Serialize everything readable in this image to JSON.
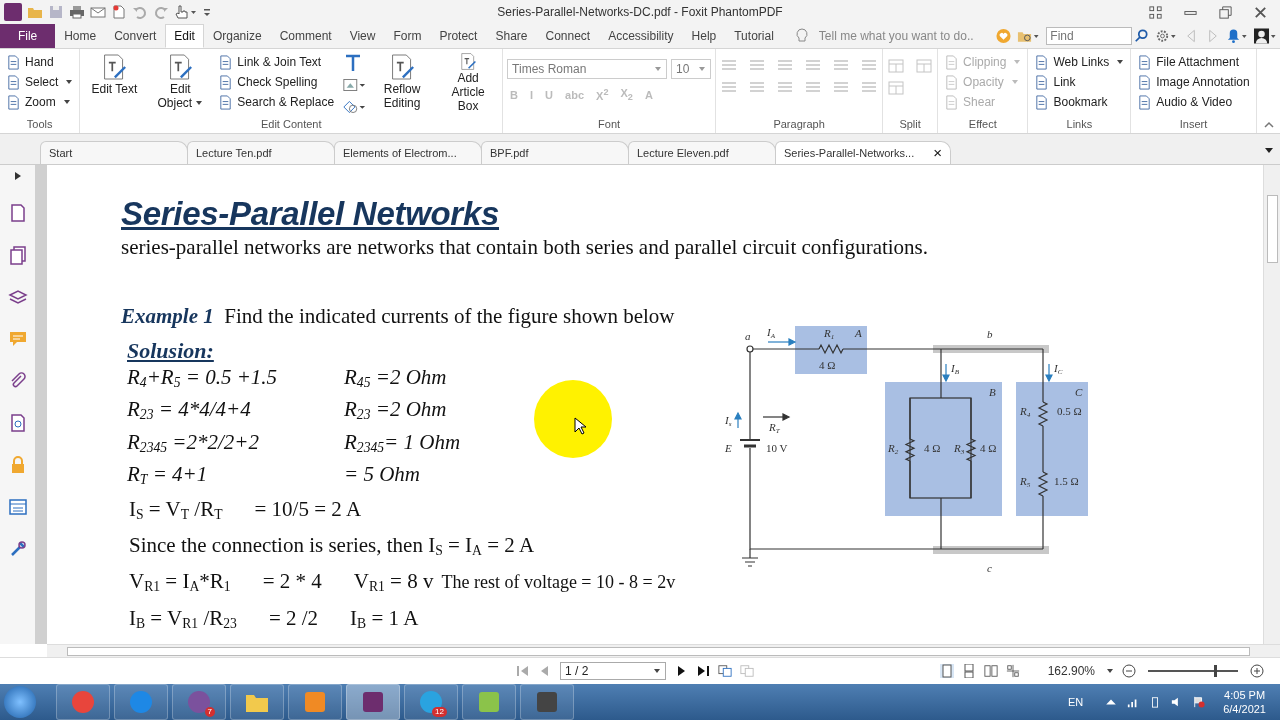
{
  "window": {
    "title": "Series-Parallel-Networks-DC.pdf - Foxit PhantomPDF"
  },
  "menu_tabs": [
    {
      "label": "File",
      "selected": false,
      "kind": "file"
    },
    {
      "label": "Home",
      "selected": false,
      "kind": "tab"
    },
    {
      "label": "Convert",
      "selected": false,
      "kind": "tab"
    },
    {
      "label": "Edit",
      "selected": true,
      "kind": "tab"
    },
    {
      "label": "Organize",
      "selected": false,
      "kind": "tab"
    },
    {
      "label": "Comment",
      "selected": false,
      "kind": "tab"
    },
    {
      "label": "View",
      "selected": false,
      "kind": "tab"
    },
    {
      "label": "Form",
      "selected": false,
      "kind": "tab"
    },
    {
      "label": "Protect",
      "selected": false,
      "kind": "tab"
    },
    {
      "label": "Share",
      "selected": false,
      "kind": "tab"
    },
    {
      "label": "Connect",
      "selected": false,
      "kind": "tab"
    },
    {
      "label": "Accessibility",
      "selected": false,
      "kind": "tab"
    },
    {
      "label": "Help",
      "selected": false,
      "kind": "tab"
    },
    {
      "label": "Tutorial",
      "selected": false,
      "kind": "tab"
    }
  ],
  "tell_me": {
    "placeholder": "Tell me what you want to do.."
  },
  "find": {
    "placeholder": "Find"
  },
  "ribbon_groups": [
    {
      "title": "Tools",
      "columns": [
        {
          "kind": "stack",
          "items": [
            {
              "label": "Hand",
              "dropdown": false,
              "disabled": false
            },
            {
              "label": "Select",
              "dropdown": true,
              "disabled": false
            },
            {
              "label": "Zoom",
              "dropdown": true,
              "disabled": false
            }
          ]
        }
      ]
    },
    {
      "title": "Edit Content",
      "columns": [
        {
          "kind": "large",
          "label": "Edit Text",
          "dropdown": false
        },
        {
          "kind": "large",
          "label": "Edit Object",
          "dropdown": true
        },
        {
          "kind": "stack",
          "items": [
            {
              "label": "Link & Join Text",
              "dropdown": false,
              "disabled": false
            },
            {
              "label": "Check Spelling",
              "dropdown": false,
              "disabled": false
            },
            {
              "label": "Search & Replace",
              "dropdown": false,
              "disabled": false
            }
          ]
        },
        {
          "kind": "format-icons"
        },
        {
          "kind": "large",
          "label": "Reflow Editing",
          "dropdown": false
        },
        {
          "kind": "large",
          "label": "Add Article Box",
          "dropdown": false
        }
      ]
    },
    {
      "title": "Font",
      "columns": [
        {
          "kind": "font",
          "font": "Times Roman",
          "size": "10",
          "buttons": [
            "B",
            "I",
            "U",
            "abc",
            "X$^{2}$",
            "X$_{2}$",
            "A"
          ]
        }
      ]
    },
    {
      "title": "Paragraph",
      "columns": [
        {
          "kind": "paragraph-icons"
        }
      ]
    },
    {
      "title": "Split",
      "columns": [
        {
          "kind": "split-icons"
        }
      ]
    },
    {
      "title": "Effect",
      "columns": [
        {
          "kind": "stack",
          "items": [
            {
              "label": "Clipping",
              "dropdown": true,
              "disabled": true
            },
            {
              "label": "Opacity",
              "dropdown": true,
              "disabled": true
            },
            {
              "label": "Shear",
              "dropdown": false,
              "disabled": true
            }
          ]
        }
      ]
    },
    {
      "title": "Links",
      "columns": [
        {
          "kind": "stack",
          "items": [
            {
              "label": "Web Links",
              "dropdown": true,
              "disabled": false
            },
            {
              "label": "Link",
              "dropdown": false,
              "disabled": false
            },
            {
              "label": "Bookmark",
              "dropdown": false,
              "disabled": false
            }
          ]
        }
      ]
    },
    {
      "title": "Insert",
      "columns": [
        {
          "kind": "stack",
          "items": [
            {
              "label": "File Attachment",
              "dropdown": false,
              "disabled": false
            },
            {
              "label": "Image Annotation",
              "dropdown": false,
              "disabled": false
            },
            {
              "label": "Audio & Video",
              "dropdown": false,
              "disabled": false
            }
          ]
        }
      ]
    }
  ],
  "doc_tabs": [
    {
      "label": "Start",
      "selected": false
    },
    {
      "label": "Lecture Ten.pdf",
      "selected": false
    },
    {
      "label": "Elements of Electrom...",
      "selected": false
    },
    {
      "label": "BPF.pdf",
      "selected": false
    },
    {
      "label": "Lecture Eleven.pdf",
      "selected": false
    },
    {
      "label": "Series-Parallel-Networks...",
      "selected": true,
      "close": "×"
    }
  ],
  "document": {
    "title": "Series-Parallel Networks",
    "intro": "series-parallel networks are networks that contain both series and parallel circuit configurations.",
    "example": {
      "label": "Example 1",
      "text": "Find the indicated currents of the figure shown below"
    },
    "solution_heading": "Solusion:",
    "calc_lines": [
      {
        "left": "R$_{4}$+R$_{5}$ = 0.5 +1.5",
        "right": "R$_{45}$  =2 Ohm"
      },
      {
        "left": "R$_{23}$ = 4*4/4+4",
        "right": "R$_{23}$  =2 Ohm"
      },
      {
        "left": "R$_{2345}$ =2*2/2+2",
        "right": "R$_{2345}$= 1 Ohm"
      },
      {
        "left": "R$_{T}$ = 4+1",
        "right": "= 5 Ohm"
      }
    ],
    "result_lines": [
      {
        "parts": [
          {
            "kind": "eq",
            "text": "I$_{S}$ = V$_{T}$ /R$_{T}$"
          },
          {
            "kind": "eq",
            "text": "= 10/5  = 2 A"
          }
        ]
      },
      {
        "parts": [
          {
            "kind": "eq",
            "text": "Since the connection is series, then I$_{S}$ = I$_{A}$ = 2 A"
          }
        ]
      },
      {
        "parts": [
          {
            "kind": "eq",
            "text": "V$_{R1}$ = I$_{A}$*R$_{1}$"
          },
          {
            "kind": "eq",
            "text": "= 2 * 4"
          },
          {
            "kind": "eq",
            "text": "V$_{R1}$ = 8 v"
          },
          {
            "kind": "note",
            "text": "The rest of voltage = 10 - 8 = 2v"
          }
        ]
      },
      {
        "parts": [
          {
            "kind": "eq",
            "text": "I$_{B}$ = V$_{R1}$ /R$_{23}$"
          },
          {
            "kind": "eq",
            "text": "= 2 /2"
          },
          {
            "kind": "eq",
            "text": "I$_{B}$ = 1 A"
          }
        ]
      }
    ],
    "circuit": {
      "node_a": "a",
      "current_a": "I$_{A}$",
      "r1_name": "R$_{1}$",
      "r1_value": "4 Ω",
      "box_a": "A",
      "node_b": "b",
      "current_b": "I$_{B}$",
      "current_c": "I$_{C}$",
      "box_b": "B",
      "box_c": "C",
      "current_s": "I$_{s}$",
      "total_r": "R$_{T}$",
      "source": "E",
      "source_value": "10 V",
      "r2_name": "R$_{2}$",
      "r2_value": "4 Ω",
      "r3_name": "R$_{3}$",
      "r3_value": "4 Ω",
      "r4_name": "R$_{4}$",
      "r4_value": "0.5 Ω",
      "r5_name": "R$_{5}$",
      "r5_value": "1.5 Ω",
      "node_c": "c"
    }
  },
  "status_bar": {
    "page": "1 / 2",
    "zoom": "162.90%",
    "zoom_slider": {
      "level": 0.75
    }
  },
  "taskbar": {
    "apps": [
      {
        "kind": "browser",
        "selected": false
      },
      {
        "kind": "globe",
        "selected": false
      },
      {
        "kind": "phone",
        "selected": false,
        "badge": "7"
      },
      {
        "kind": "folder",
        "selected": false
      },
      {
        "kind": "player",
        "selected": false
      },
      {
        "kind": "pdf",
        "selected": true
      },
      {
        "kind": "plane",
        "selected": false,
        "badge": "12"
      },
      {
        "kind": "leaf",
        "selected": false
      },
      {
        "kind": "camera",
        "selected": false
      }
    ],
    "language": "EN",
    "time": "4:05 PM",
    "date": "6/4/2021"
  }
}
